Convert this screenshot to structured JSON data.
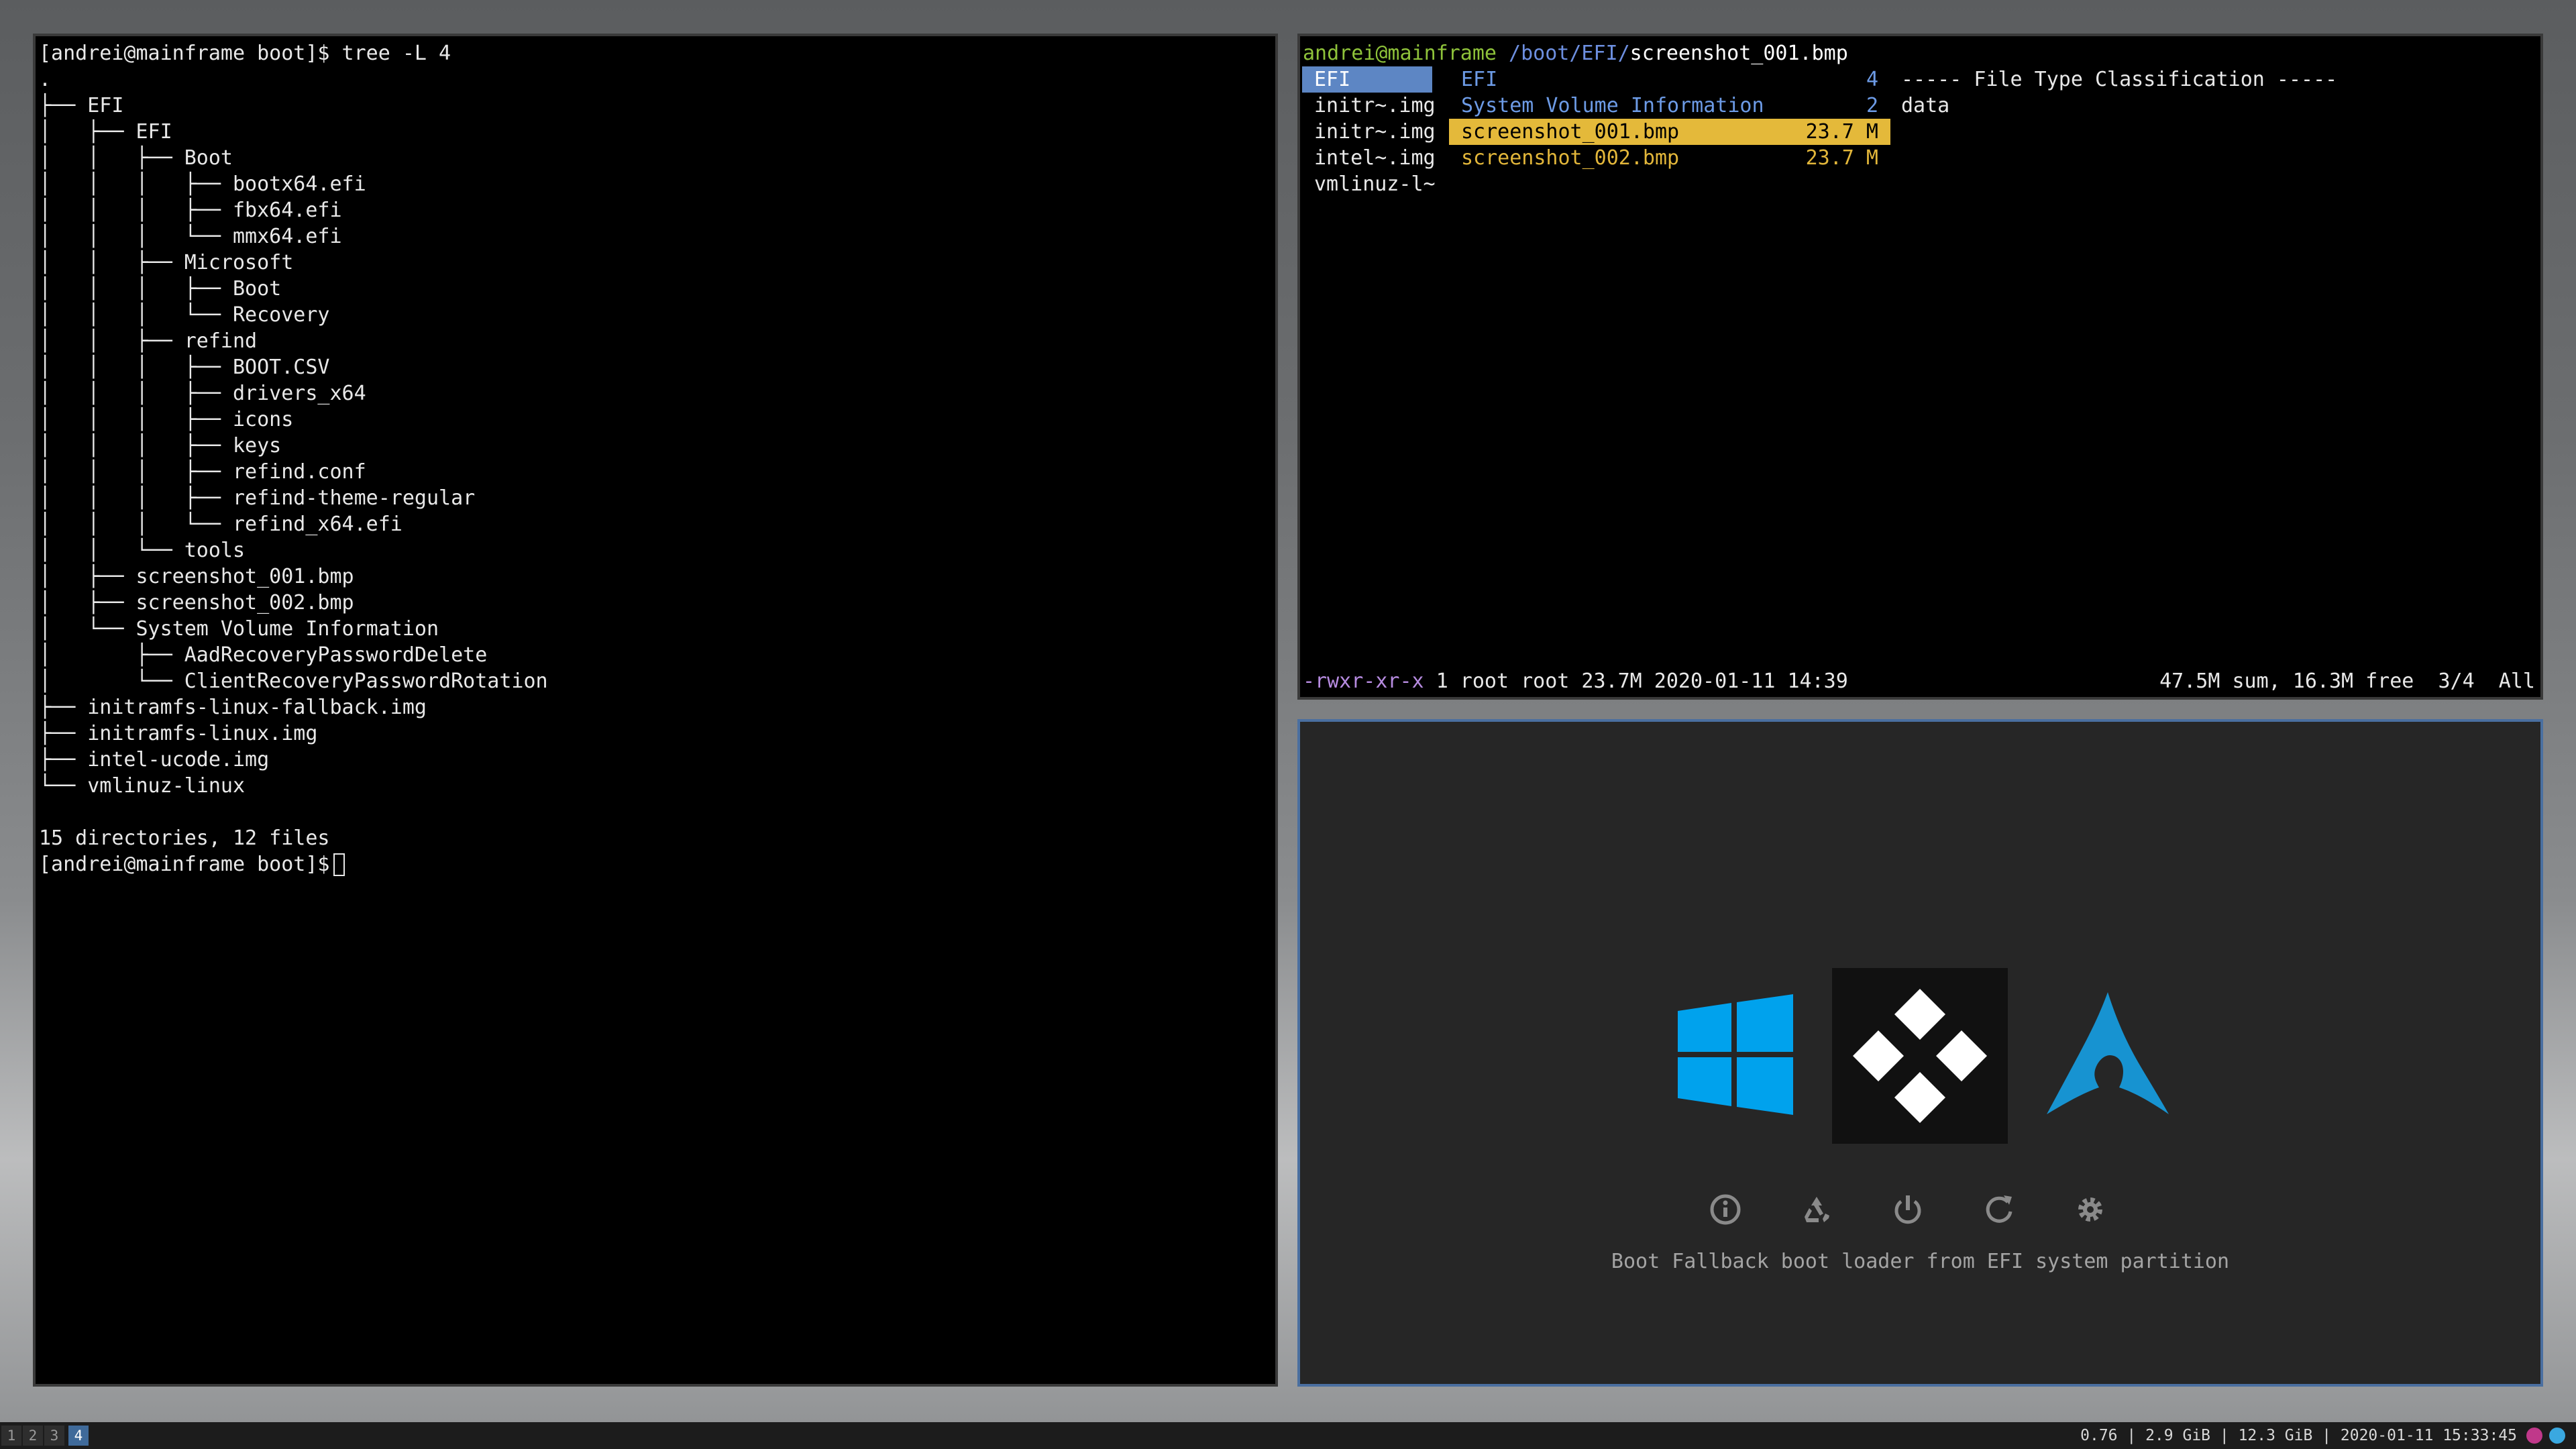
{
  "terminal": {
    "lines": [
      "[andrei@mainframe boot]$ tree -L 4",
      ".",
      "├── EFI",
      "│   ├── EFI",
      "│   │   ├── Boot",
      "│   │   │   ├── bootx64.efi",
      "│   │   │   ├── fbx64.efi",
      "│   │   │   └── mmx64.efi",
      "│   │   ├── Microsoft",
      "│   │   │   ├── Boot",
      "│   │   │   └── Recovery",
      "│   │   ├── refind",
      "│   │   │   ├── BOOT.CSV",
      "│   │   │   ├── drivers_x64",
      "│   │   │   ├── icons",
      "│   │   │   ├── keys",
      "│   │   │   ├── refind.conf",
      "│   │   │   ├── refind-theme-regular",
      "│   │   │   └── refind_x64.efi",
      "│   │   └── tools",
      "│   ├── screenshot_001.bmp",
      "│   ├── screenshot_002.bmp",
      "│   └── System Volume Information",
      "│       ├── AadRecoveryPasswordDelete",
      "│       └── ClientRecoveryPasswordRotation",
      "├── initramfs-linux-fallback.img",
      "├── initramfs-linux.img",
      "├── intel-ucode.img",
      "└── vmlinuz-linux",
      "",
      "15 directories, 12 files"
    ],
    "prompt": "[andrei@mainframe boot]$"
  },
  "ranger": {
    "title_user": "andrei@mainframe",
    "title_path": "/boot/EFI/",
    "title_file": "screenshot_001.bmp",
    "parent": [
      "EFI",
      "initr~.img",
      "initr~.img",
      "intel~.img",
      "vmlinuz-l~"
    ],
    "current": [
      {
        "name": "EFI",
        "size": "4"
      },
      {
        "name": "System Volume Information",
        "size": "2"
      },
      {
        "name": "screenshot_001.bmp",
        "size": "23.7 M"
      },
      {
        "name": "screenshot_002.bmp",
        "size": "23.7 M"
      }
    ],
    "preview_header": "----- File Type Classification -----",
    "preview_value": "data",
    "status_perm": "-rwxr-xr-x",
    "status_info": "1 root root 23.7M 2020-01-11 14:39",
    "status_right": "47.5M sum, 16.3M free  3/4  All"
  },
  "refind": {
    "os_icons": [
      "windows-icon",
      "refind-fallback-icon",
      "arch-linux-icon"
    ],
    "tool_icons": [
      "about-icon",
      "recycle-icon",
      "shutdown-icon",
      "reboot-icon",
      "settings-icon"
    ],
    "description": "Boot Fallback boot loader from EFI system partition"
  },
  "statusbar": {
    "workspaces": [
      "1",
      "2",
      "3",
      "4"
    ],
    "active_workspace": "4",
    "load": "0.76",
    "mem": "2.9 GiB",
    "disk": "12.3 GiB",
    "datetime": "2020-01-11 15:33:45"
  },
  "colors": {
    "selection_blue": "#5d86c4",
    "selection_yellow": "#e4b93a",
    "windows_blue": "#00a2ed",
    "arch_blue": "#1793d1"
  }
}
